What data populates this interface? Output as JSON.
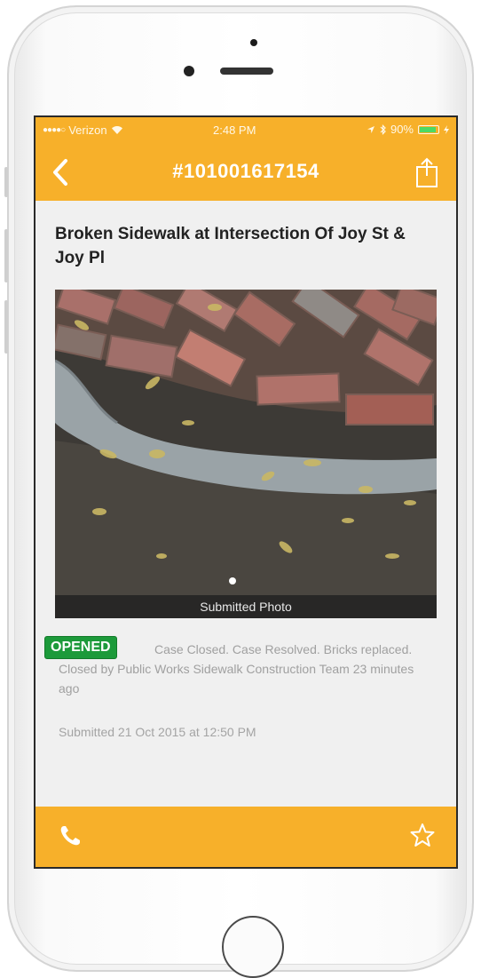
{
  "status_bar": {
    "carrier": "Verizon",
    "time": "2:48 PM",
    "battery": "90%",
    "battery_level": 0.9
  },
  "nav": {
    "title": "#101001617154",
    "back_icon": "chevron-left-icon",
    "share_icon": "share-icon"
  },
  "case": {
    "title": "Broken Sidewalk at Intersection Of Joy St & Joy Pl",
    "photo_caption": "Submitted Photo",
    "status_badge": "OPENED",
    "status_detail": "Case Closed. Case Resolved. Bricks replaced. Closed by Public Works Sidewalk Construction Team 23 minutes ago",
    "submitted": "Submitted 21 Oct 2015 at 12:50 PM"
  },
  "tab_bar": {
    "phone_icon": "phone-icon",
    "star_icon": "star-icon"
  },
  "colors": {
    "accent": "#f7b02a",
    "badge_green": "#1c9a3a",
    "screen_bg": "#f0f0f0"
  }
}
